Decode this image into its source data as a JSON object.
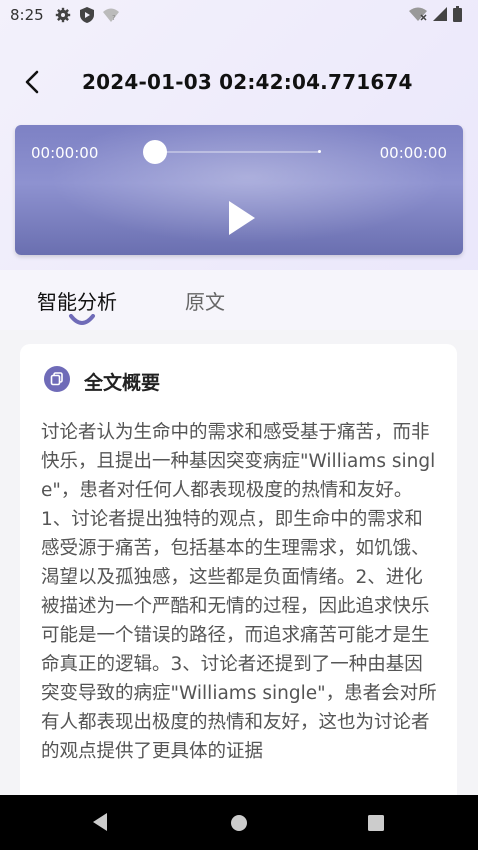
{
  "status_bar": {
    "time": "8:25",
    "icons_left": [
      "gear-icon",
      "shield-icon",
      "wifi-unknown-icon"
    ],
    "icons_right": [
      "wifi-off-icon",
      "signal-icon",
      "battery-icon"
    ]
  },
  "header": {
    "title": "2024-01-03 02:42:04.771674",
    "back_icon": "back-arrow-icon"
  },
  "player": {
    "current_time": "00:00:00",
    "total_time": "00:00:00",
    "progress": 0,
    "play_icon": "play-icon"
  },
  "tabs": [
    {
      "label": "智能分析",
      "active": true
    },
    {
      "label": "原文",
      "active": false
    }
  ],
  "summary": {
    "icon": "copy-icon",
    "title": "全文概要",
    "text": "讨论者认为生命中的需求和感受基于痛苦，而非快乐，且提出一种基因突变病症\"Williams single\"，患者对任何人都表现极度的热情和友好。1、讨论者提出独特的观点，即生命中的需求和感受源于痛苦，包括基本的生理需求，如饥饿、渴望以及孤独感，这些都是负面情绪。2、进化被描述为一个严酷和无情的过程，因此追求快乐可能是一个错误的路径，而追求痛苦可能才是生命真正的逻辑。3、讨论者还提到了一种由基因突变导致的病症\"Williams single\"，患者会对所有人都表现出极度的热情和友好，这也为讨论者的观点提供了更具体的证据"
  },
  "colors": {
    "accent": "#6f6bb8",
    "player_bg": "#7d81c4",
    "nav_bar": "#000000"
  },
  "nav": [
    "back-triangle-icon",
    "home-circle-icon",
    "recents-square-icon"
  ]
}
